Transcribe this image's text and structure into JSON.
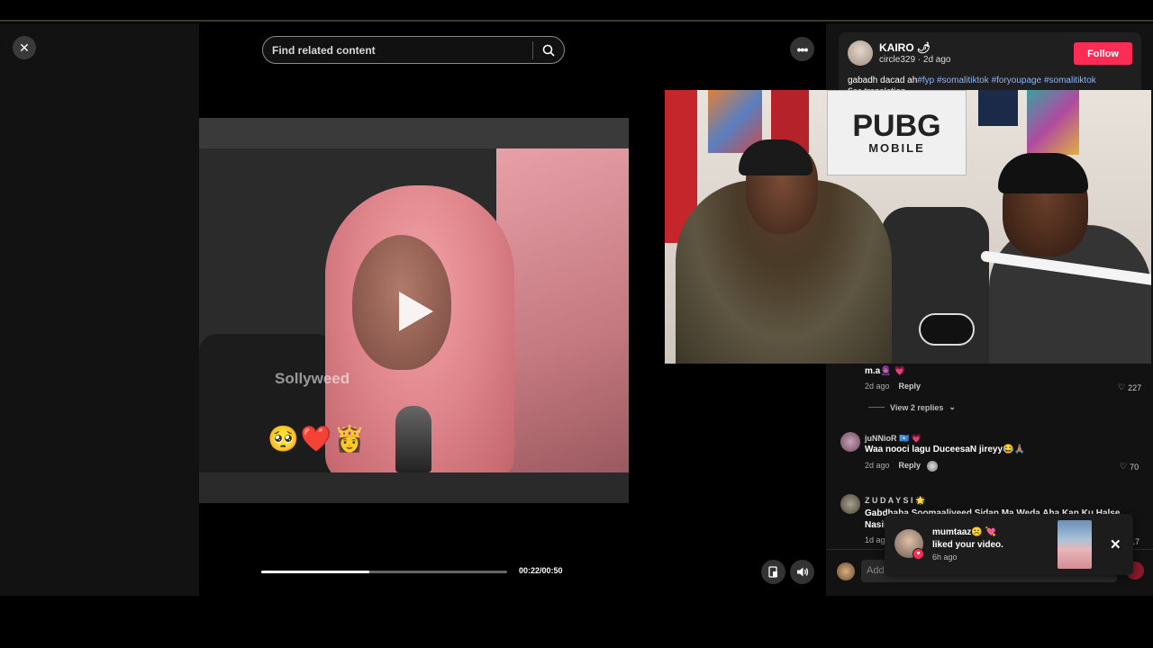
{
  "search": {
    "placeholder": "Find related content"
  },
  "video": {
    "watermark": "Sollyweed",
    "emojis": "🥺❤️👸",
    "current_time": "00:22/00:50",
    "progress_fraction": 0.44
  },
  "post": {
    "author": "KAIRO 🌶",
    "handle": "circle329 · 2d ago",
    "follow_label": "Follow",
    "caption_text": "gabadh dacad ah",
    "hashtags": [
      "#fyp",
      "#somalitiktok",
      "#foryoupage",
      "#somalitiktok"
    ],
    "see_translation": "See translation"
  },
  "facecam": {
    "poster_title": "PUBG",
    "poster_subtitle": "MOBILE"
  },
  "comments": [
    {
      "text": "m.a🧕🏽 💗",
      "time": "2d ago",
      "reply_label": "Reply",
      "likes": "227",
      "view_replies": "View 2 replies"
    },
    {
      "name": "juNNioR 🇸🇴 💗",
      "text": "Waa nooci lagu DuceesaN jireyy😂🙏🏽",
      "time": "2d ago",
      "reply_label": "Reply",
      "likes": "70"
    },
    {
      "name": "Z U D A Y S I 🌟",
      "text_line1": "Gabdhaha Soomaaliyeed Sidan Ma Weda Aha Kan Ku Halse",
      "text_line2": "Nasii",
      "time": "1d ago",
      "likes": "17"
    }
  ],
  "comment_input": {
    "placeholder": "Add comment..."
  },
  "notification": {
    "name": "mumtaaz☹️ 💘",
    "message": "liked your video.",
    "time": "6h ago"
  },
  "colors": {
    "accent": "#fe2c55",
    "hashtag": "#8ab4f8",
    "panel_bg": "#121212"
  }
}
